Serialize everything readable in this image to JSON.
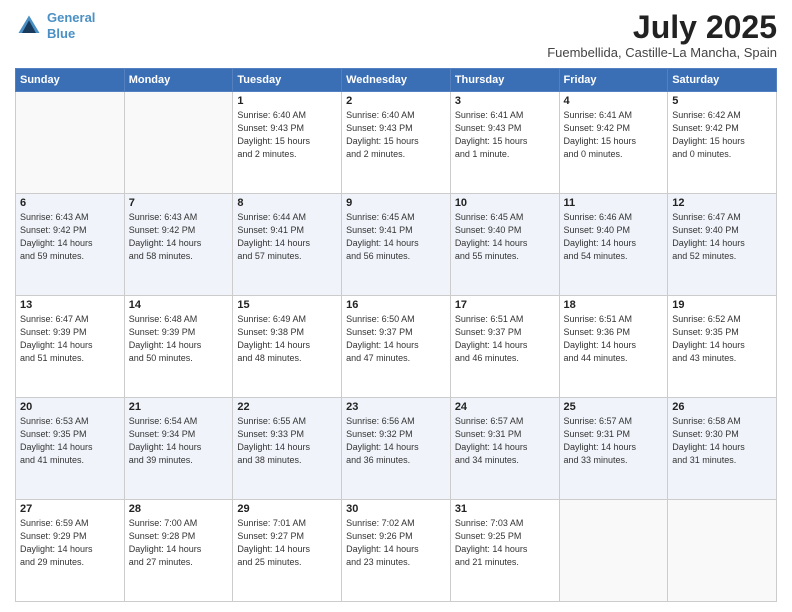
{
  "header": {
    "logo_line1": "General",
    "logo_line2": "Blue",
    "month": "July 2025",
    "location": "Fuembellida, Castille-La Mancha, Spain"
  },
  "weekdays": [
    "Sunday",
    "Monday",
    "Tuesday",
    "Wednesday",
    "Thursday",
    "Friday",
    "Saturday"
  ],
  "weeks": [
    [
      {
        "day": "",
        "info": ""
      },
      {
        "day": "",
        "info": ""
      },
      {
        "day": "1",
        "info": "Sunrise: 6:40 AM\nSunset: 9:43 PM\nDaylight: 15 hours\nand 2 minutes."
      },
      {
        "day": "2",
        "info": "Sunrise: 6:40 AM\nSunset: 9:43 PM\nDaylight: 15 hours\nand 2 minutes."
      },
      {
        "day": "3",
        "info": "Sunrise: 6:41 AM\nSunset: 9:43 PM\nDaylight: 15 hours\nand 1 minute."
      },
      {
        "day": "4",
        "info": "Sunrise: 6:41 AM\nSunset: 9:42 PM\nDaylight: 15 hours\nand 0 minutes."
      },
      {
        "day": "5",
        "info": "Sunrise: 6:42 AM\nSunset: 9:42 PM\nDaylight: 15 hours\nand 0 minutes."
      }
    ],
    [
      {
        "day": "6",
        "info": "Sunrise: 6:43 AM\nSunset: 9:42 PM\nDaylight: 14 hours\nand 59 minutes."
      },
      {
        "day": "7",
        "info": "Sunrise: 6:43 AM\nSunset: 9:42 PM\nDaylight: 14 hours\nand 58 minutes."
      },
      {
        "day": "8",
        "info": "Sunrise: 6:44 AM\nSunset: 9:41 PM\nDaylight: 14 hours\nand 57 minutes."
      },
      {
        "day": "9",
        "info": "Sunrise: 6:45 AM\nSunset: 9:41 PM\nDaylight: 14 hours\nand 56 minutes."
      },
      {
        "day": "10",
        "info": "Sunrise: 6:45 AM\nSunset: 9:40 PM\nDaylight: 14 hours\nand 55 minutes."
      },
      {
        "day": "11",
        "info": "Sunrise: 6:46 AM\nSunset: 9:40 PM\nDaylight: 14 hours\nand 54 minutes."
      },
      {
        "day": "12",
        "info": "Sunrise: 6:47 AM\nSunset: 9:40 PM\nDaylight: 14 hours\nand 52 minutes."
      }
    ],
    [
      {
        "day": "13",
        "info": "Sunrise: 6:47 AM\nSunset: 9:39 PM\nDaylight: 14 hours\nand 51 minutes."
      },
      {
        "day": "14",
        "info": "Sunrise: 6:48 AM\nSunset: 9:39 PM\nDaylight: 14 hours\nand 50 minutes."
      },
      {
        "day": "15",
        "info": "Sunrise: 6:49 AM\nSunset: 9:38 PM\nDaylight: 14 hours\nand 48 minutes."
      },
      {
        "day": "16",
        "info": "Sunrise: 6:50 AM\nSunset: 9:37 PM\nDaylight: 14 hours\nand 47 minutes."
      },
      {
        "day": "17",
        "info": "Sunrise: 6:51 AM\nSunset: 9:37 PM\nDaylight: 14 hours\nand 46 minutes."
      },
      {
        "day": "18",
        "info": "Sunrise: 6:51 AM\nSunset: 9:36 PM\nDaylight: 14 hours\nand 44 minutes."
      },
      {
        "day": "19",
        "info": "Sunrise: 6:52 AM\nSunset: 9:35 PM\nDaylight: 14 hours\nand 43 minutes."
      }
    ],
    [
      {
        "day": "20",
        "info": "Sunrise: 6:53 AM\nSunset: 9:35 PM\nDaylight: 14 hours\nand 41 minutes."
      },
      {
        "day": "21",
        "info": "Sunrise: 6:54 AM\nSunset: 9:34 PM\nDaylight: 14 hours\nand 39 minutes."
      },
      {
        "day": "22",
        "info": "Sunrise: 6:55 AM\nSunset: 9:33 PM\nDaylight: 14 hours\nand 38 minutes."
      },
      {
        "day": "23",
        "info": "Sunrise: 6:56 AM\nSunset: 9:32 PM\nDaylight: 14 hours\nand 36 minutes."
      },
      {
        "day": "24",
        "info": "Sunrise: 6:57 AM\nSunset: 9:31 PM\nDaylight: 14 hours\nand 34 minutes."
      },
      {
        "day": "25",
        "info": "Sunrise: 6:57 AM\nSunset: 9:31 PM\nDaylight: 14 hours\nand 33 minutes."
      },
      {
        "day": "26",
        "info": "Sunrise: 6:58 AM\nSunset: 9:30 PM\nDaylight: 14 hours\nand 31 minutes."
      }
    ],
    [
      {
        "day": "27",
        "info": "Sunrise: 6:59 AM\nSunset: 9:29 PM\nDaylight: 14 hours\nand 29 minutes."
      },
      {
        "day": "28",
        "info": "Sunrise: 7:00 AM\nSunset: 9:28 PM\nDaylight: 14 hours\nand 27 minutes."
      },
      {
        "day": "29",
        "info": "Sunrise: 7:01 AM\nSunset: 9:27 PM\nDaylight: 14 hours\nand 25 minutes."
      },
      {
        "day": "30",
        "info": "Sunrise: 7:02 AM\nSunset: 9:26 PM\nDaylight: 14 hours\nand 23 minutes."
      },
      {
        "day": "31",
        "info": "Sunrise: 7:03 AM\nSunset: 9:25 PM\nDaylight: 14 hours\nand 21 minutes."
      },
      {
        "day": "",
        "info": ""
      },
      {
        "day": "",
        "info": ""
      }
    ]
  ]
}
